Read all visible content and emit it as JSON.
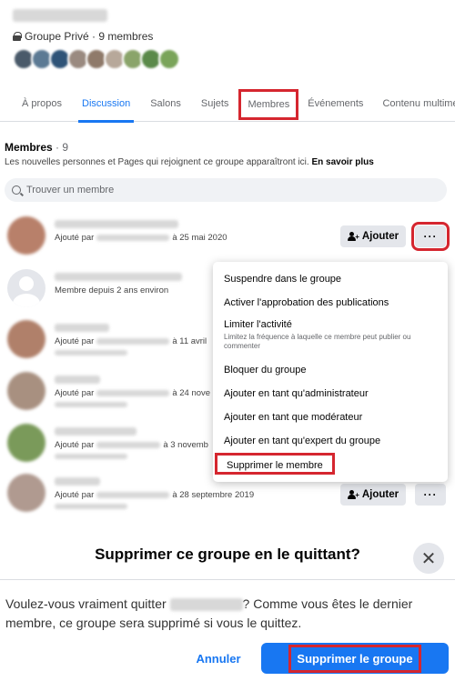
{
  "group": {
    "privacy_text": "Groupe Privé · 9 membres",
    "avatar_colors": [
      "#4a5a6a",
      "#5c7a94",
      "#2f5478",
      "#9a8a80",
      "#8f7a6a",
      "#b7a89a",
      "#8aa46a",
      "#5b8a4a",
      "#7aa45a"
    ]
  },
  "tabs": [
    {
      "label": "À propos"
    },
    {
      "label": "Discussion"
    },
    {
      "label": "Salons"
    },
    {
      "label": "Sujets"
    },
    {
      "label": "Membres"
    },
    {
      "label": "Événements"
    },
    {
      "label": "Contenu multimédia"
    }
  ],
  "members_section": {
    "title": "Membres",
    "count": "· 9",
    "description": "Les nouvelles personnes et Pages qui rejoignent ce groupe apparaîtront ici.",
    "learn_more": "En savoir plus",
    "search_placeholder": "Trouver un membre"
  },
  "members": [
    {
      "added_prefix": "Ajouté par",
      "date": "à 25 mai 2020",
      "avatar_color": "#b8806a",
      "show_add": true
    },
    {
      "added_prefix": "Membre depuis 2 ans environ",
      "date": "",
      "avatar_color": "default",
      "show_add": false
    },
    {
      "added_prefix": "Ajouté par",
      "date": "à 11 avril",
      "avatar_color": "#b0806a",
      "show_add": false
    },
    {
      "added_prefix": "Ajouté par",
      "date": "à 24 nove",
      "avatar_color": "#a89080",
      "show_add": false
    },
    {
      "added_prefix": "Ajouté par",
      "date": "à 3 novemb",
      "avatar_color": "#7a9a5a",
      "show_add": false
    },
    {
      "added_prefix": "Ajouté par",
      "date": "à 28 septembre 2019",
      "avatar_color": "#b09a90",
      "show_add": true
    }
  ],
  "buttons": {
    "add_label": "Ajouter",
    "more_label": "···"
  },
  "menu": {
    "items": [
      {
        "label": "Suspendre dans le groupe"
      },
      {
        "label": "Activer l'approbation des publications"
      },
      {
        "label": "Limiter l'activité",
        "description": "Limitez la fréquence à laquelle ce membre peut publier ou commenter"
      },
      {
        "label": "Bloquer du groupe"
      },
      {
        "label": "Ajouter en tant qu'administrateur"
      },
      {
        "label": "Ajouter en tant que modérateur"
      },
      {
        "label": "Ajouter en tant qu'expert du groupe"
      },
      {
        "label": "Supprimer le membre"
      }
    ]
  },
  "modal": {
    "title": "Supprimer ce groupe en le quittant?",
    "body_before": "Voulez-vous vraiment quitter",
    "body_after": "? Comme vous êtes le dernier membre, ce groupe sera supprimé si vous le quittez.",
    "cancel_label": "Annuler",
    "confirm_label": "Supprimer le groupe",
    "close_icon": "close-icon"
  },
  "colors": {
    "accent": "#1877f2",
    "highlight": "#d5262f"
  }
}
